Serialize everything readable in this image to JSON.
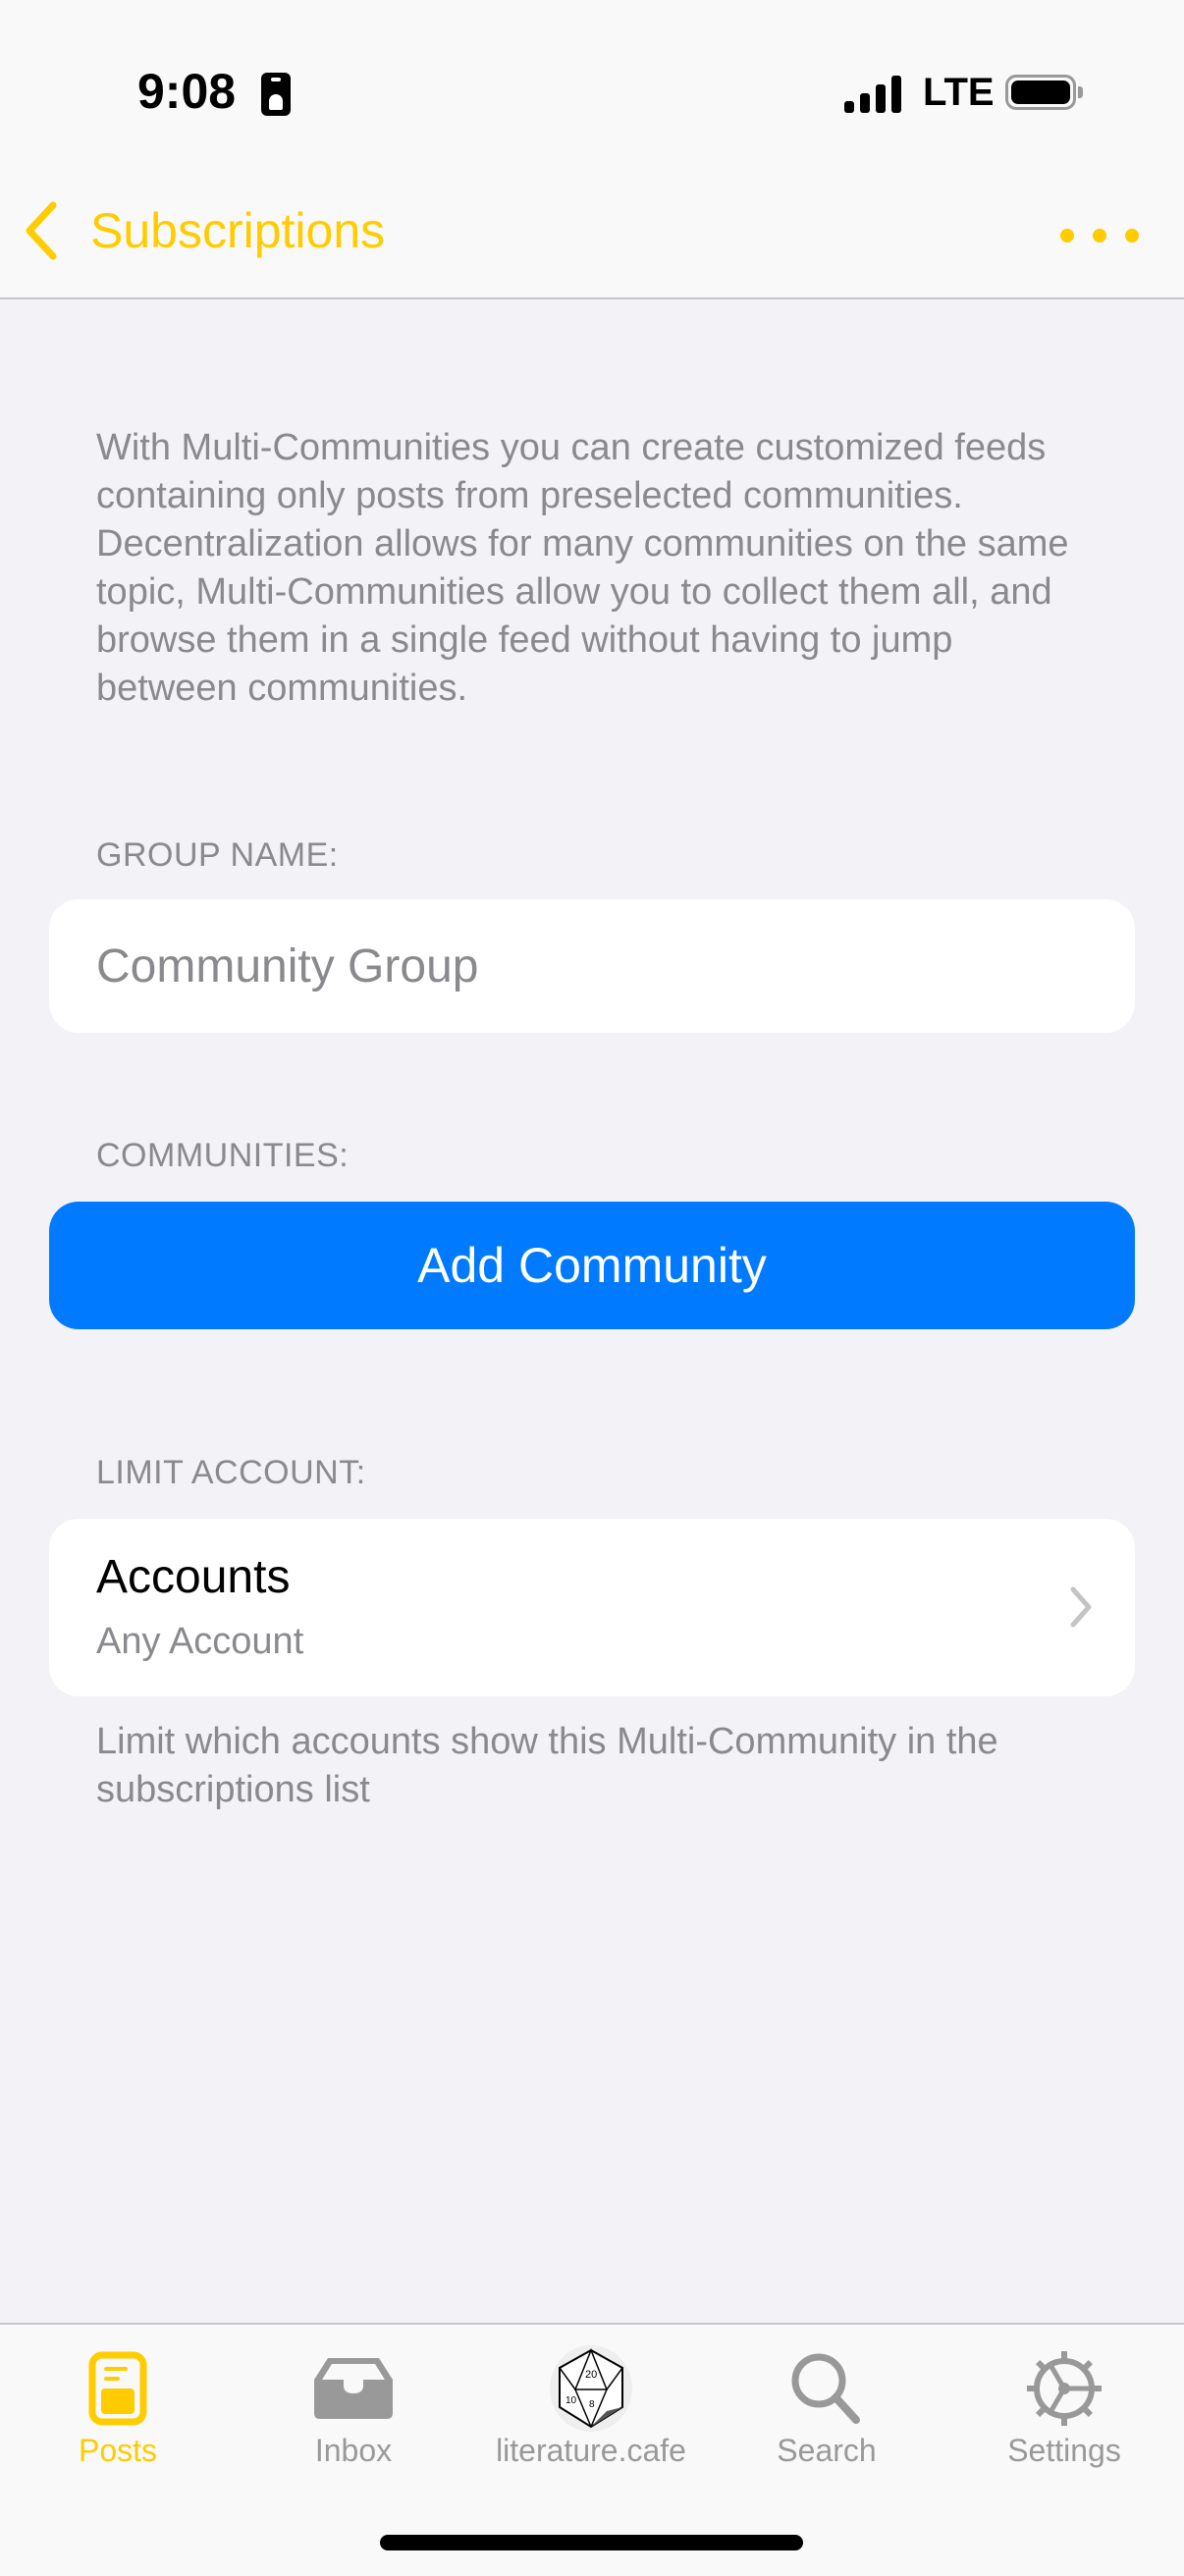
{
  "status_bar": {
    "time": "9:08",
    "network": "LTE",
    "icons": [
      "portrait-lock-icon",
      "signal-icon",
      "battery-icon"
    ]
  },
  "nav": {
    "back_label": "Subscriptions",
    "back_icon": "chevron-left-icon",
    "more_icon": "ellipsis-icon"
  },
  "description": "With Multi-Communities you can create customized feeds containing only posts from preselected communities. Decentralization allows for many communities on the same topic, Multi-Communities allow you to collect them all, and browse them in a single feed without having to jump between communities.",
  "group_name": {
    "label": "GROUP NAME:",
    "value": "",
    "placeholder": "Community Group"
  },
  "communities": {
    "label": "COMMUNITIES:",
    "add_button": "Add Community"
  },
  "limit_account": {
    "label": "LIMIT ACCOUNT:",
    "row_title": "Accounts",
    "row_value": "Any Account",
    "footnote": "Limit which accounts show this Multi-Community in the subscriptions list"
  },
  "tab_bar": {
    "active": "Posts",
    "tabs": [
      {
        "label": "Posts",
        "icon": "posts-icon"
      },
      {
        "label": "Inbox",
        "icon": "inbox-tray-icon"
      },
      {
        "label": "literature.cafe",
        "icon": "d20-dice-avatar-icon"
      },
      {
        "label": "Search",
        "icon": "magnifying-glass-icon"
      },
      {
        "label": "Settings",
        "icon": "gear-icon"
      }
    ]
  },
  "colors": {
    "accent": "#FFCC00",
    "primary_button": "#007AFF",
    "background": "#F2F2F7",
    "secondary_text": "#8A8A8E",
    "inactive_tab": "#999999"
  }
}
